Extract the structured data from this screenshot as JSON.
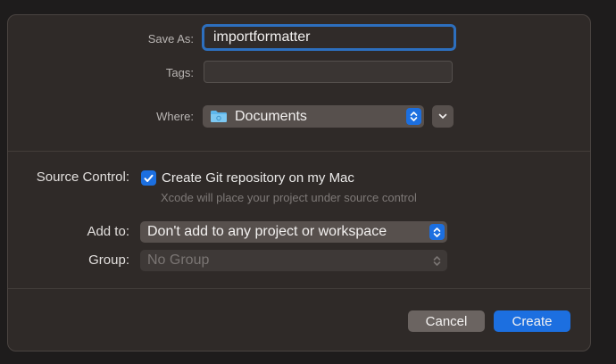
{
  "save_as": {
    "label": "Save As:",
    "value": "importformatter"
  },
  "tags": {
    "label": "Tags:",
    "value": ""
  },
  "where": {
    "label": "Where:",
    "value": "Documents"
  },
  "source_control": {
    "label": "Source Control:",
    "checkbox_label": "Create Git repository on my Mac",
    "checked": true,
    "hint": "Xcode will place your project under source control"
  },
  "add_to": {
    "label": "Add to:",
    "value": "Don't add to any project or workspace"
  },
  "group": {
    "label": "Group:",
    "value": "No Group"
  },
  "buttons": {
    "cancel": "Cancel",
    "create": "Create"
  },
  "colors": {
    "accent": "#1c6fe0",
    "dialog_bg": "#2f2a28"
  }
}
